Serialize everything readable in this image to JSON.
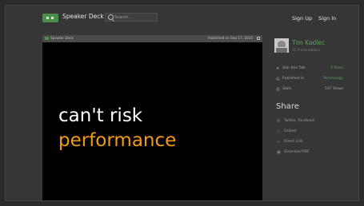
{
  "header": {
    "brand": "Speaker Deck",
    "search_placeholder": "Search...",
    "sign_up": "Sign Up",
    "sign_in": "Sign In"
  },
  "player": {
    "source_label": "Speaker Deck",
    "published_label": "Published on Sep 17, 2015",
    "slide_line1": "can't risk",
    "slide_line2": "performance"
  },
  "sidebar": {
    "author_name": "Tim Kadlec",
    "author_sub": "33 Presentations",
    "stats": [
      {
        "icon": "star-icon",
        "label": "Star this Talk",
        "value": "5 Stars"
      },
      {
        "icon": "calendar-icon",
        "label": "Published in",
        "value": "Technology"
      },
      {
        "icon": "stats-icon",
        "label": "Stats",
        "value": "537 Views"
      }
    ],
    "share_heading": "Share",
    "share_items": [
      {
        "icon": "twitter-icon",
        "label": "Twitter, Facebook"
      },
      {
        "icon": "embed-icon",
        "label": "Embed"
      },
      {
        "icon": "link-icon",
        "label": "Direct Link"
      },
      {
        "icon": "download-icon",
        "label": "Download PDF"
      }
    ]
  },
  "colors": {
    "accent_green": "#5fa05f",
    "slide_highlight": "#f29a16",
    "background": "#363636"
  }
}
